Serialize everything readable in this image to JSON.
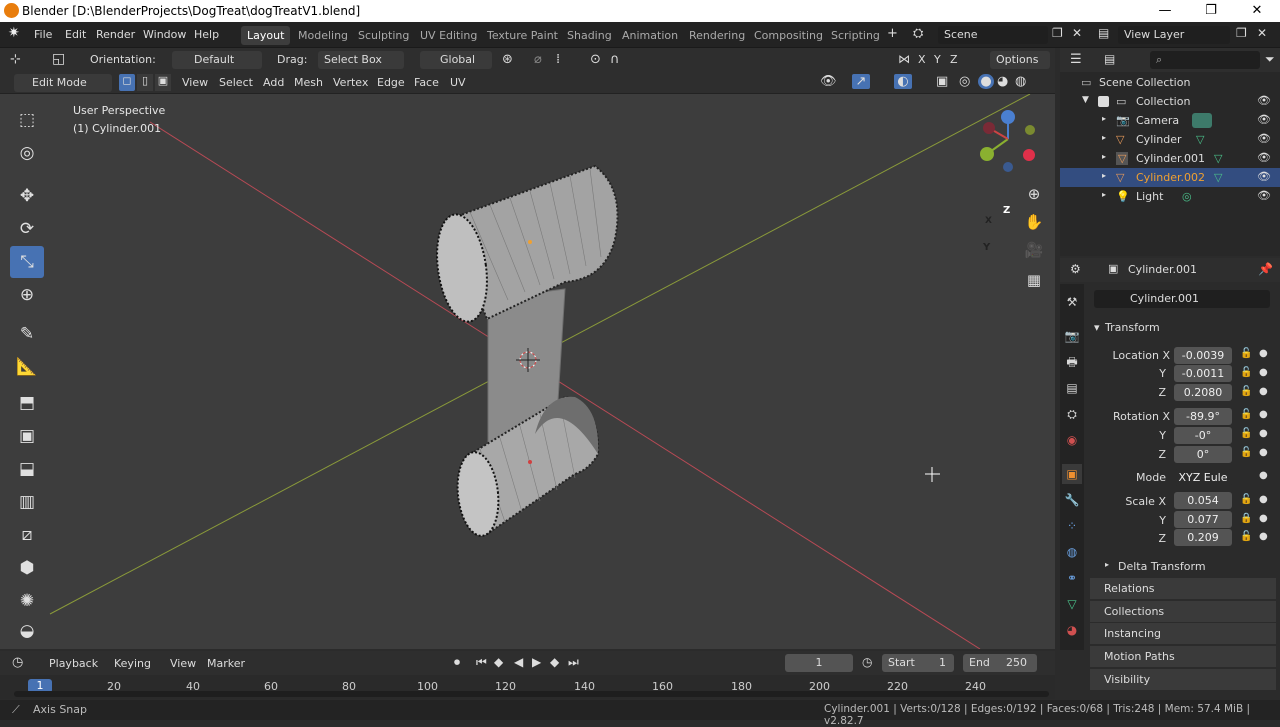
{
  "window": {
    "title": "Blender [D:\\BlenderProjects\\DogTreat\\dogTreatV1.blend]",
    "minimize": "—",
    "maximize": "❐",
    "close": "✕"
  },
  "menubar": {
    "items": [
      "File",
      "Edit",
      "Render",
      "Window",
      "Help"
    ]
  },
  "workspaces": [
    "Layout",
    "Modeling",
    "Sculpting",
    "UV Editing",
    "Texture Paint",
    "Shading",
    "Animation",
    "Rendering",
    "Compositing",
    "Scripting"
  ],
  "add_workspace": "+",
  "scene": {
    "label": "Scene",
    "view_layer": "View Layer"
  },
  "tool_header": {
    "orientation_label": "Orientation:",
    "orientation_value": "Default",
    "drag_label": "Drag:",
    "drag_value": "Select Box",
    "transform_orientation": "Global",
    "axes": [
      "X",
      "Y",
      "Z"
    ],
    "options": "Options"
  },
  "mode_header": {
    "mode": "Edit Mode",
    "menus": [
      "View",
      "Select",
      "Add",
      "Mesh",
      "Vertex",
      "Edge",
      "Face",
      "UV"
    ]
  },
  "viewport": {
    "perspective": "User Perspective",
    "object": "(1) Cylinder.001",
    "gizmo": {
      "x": "X",
      "y": "Y",
      "z": "Z"
    }
  },
  "toolbar": {
    "tools": [
      "select-box-icon",
      "cursor-icon",
      "move-icon",
      "rotate-icon",
      "scale-icon",
      "transform-icon",
      "annotate-icon",
      "measure-icon",
      "extrude-icon",
      "inset-icon",
      "bevel-icon",
      "loop-cut-icon",
      "knife-icon",
      "poly-build-icon",
      "spin-icon",
      "smooth-icon"
    ],
    "active_index": 4
  },
  "outliner": {
    "root": "Scene Collection",
    "collection": "Collection",
    "items": [
      {
        "name": "Camera",
        "icon": "camera-icon",
        "selected": false
      },
      {
        "name": "Cylinder",
        "icon": "mesh-icon",
        "selected": false
      },
      {
        "name": "Cylinder.001",
        "icon": "mesh-icon",
        "selected": false
      },
      {
        "name": "Cylinder.002",
        "icon": "mesh-icon",
        "selected": true
      },
      {
        "name": "Light",
        "icon": "light-icon",
        "selected": false
      }
    ]
  },
  "properties": {
    "object_name": "Cylinder.001",
    "datablock": "Cylinder.001",
    "transform_title": "Transform",
    "location": {
      "label": "Location X",
      "x": "-0.0039",
      "y": "-0.0011",
      "z": "0.2080"
    },
    "rotation": {
      "label": "Rotation X",
      "x": "-89.9°",
      "y": "-0°",
      "z": "0°"
    },
    "mode": {
      "label": "Mode",
      "value": "XYZ Eule"
    },
    "scale": {
      "label": "Scale X",
      "x": "0.054",
      "y": "0.077",
      "z": "0.209"
    },
    "axis_y": "Y",
    "axis_z": "Z",
    "delta_transform": "Delta Transform",
    "panels": [
      "Relations",
      "Collections",
      "Instancing",
      "Motion Paths",
      "Visibility"
    ]
  },
  "timeline": {
    "menus": [
      "Playback",
      "Keying",
      "View",
      "Marker"
    ],
    "current_frame": "1",
    "start_label": "Start",
    "start": "1",
    "end_label": "End",
    "end": "250",
    "ticks": [
      "1",
      "20",
      "40",
      "60",
      "80",
      "100",
      "120",
      "140",
      "160",
      "180",
      "200",
      "220",
      "240"
    ]
  },
  "status": {
    "left": "Axis Snap",
    "right": "Cylinder.001 | Verts:0/128 | Edges:0/192 | Faces:0/68 | Tris:248 | Mem: 57.4 MiB | v2.82.7"
  },
  "colors": {
    "accent": "#4772b3",
    "selected_row": "#334d80",
    "highlight_text": "#f0a030",
    "x_axis": "#b84a55",
    "y_axis": "#8a9a3a"
  }
}
